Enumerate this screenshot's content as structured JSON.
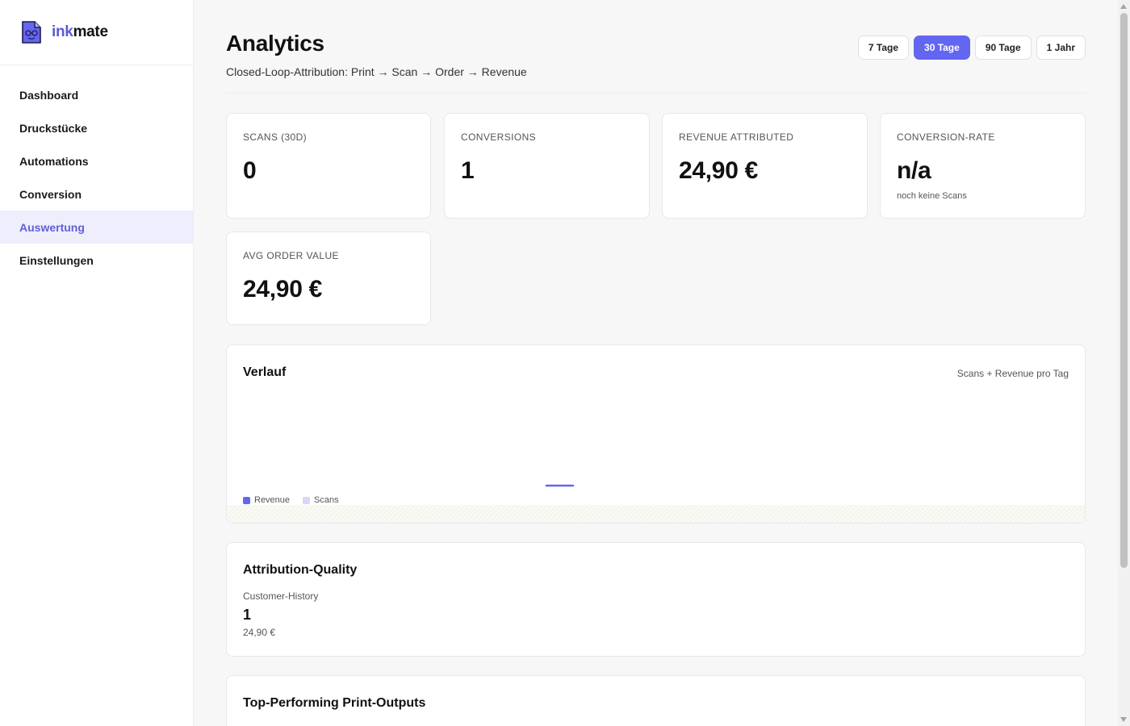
{
  "brand": {
    "ink": "ink",
    "mate": "mate",
    "accent": "#5b5bd6"
  },
  "sidebar": {
    "items": [
      {
        "label": "Dashboard",
        "active": false
      },
      {
        "label": "Druckstücke",
        "active": false
      },
      {
        "label": "Automations",
        "active": false
      },
      {
        "label": "Conversion",
        "active": false
      },
      {
        "label": "Auswertung",
        "active": true
      },
      {
        "label": "Einstellungen",
        "active": false
      }
    ]
  },
  "header": {
    "title": "Analytics",
    "subtitle": "Closed-Loop-Attribution: Print → Scan → Order → Revenue",
    "ranges": [
      {
        "label": "7 Tage",
        "active": false
      },
      {
        "label": "30 Tage",
        "active": true
      },
      {
        "label": "90 Tage",
        "active": false
      },
      {
        "label": "1 Jahr",
        "active": false
      }
    ]
  },
  "kpis": [
    {
      "label": "SCANS (30D)",
      "value": "0",
      "hint": ""
    },
    {
      "label": "CONVERSIONS",
      "value": "1",
      "hint": ""
    },
    {
      "label": "REVENUE ATTRIBUTED",
      "value": "24,90 €",
      "hint": ""
    },
    {
      "label": "CONVERSION-RATE",
      "value": "n/a",
      "hint": "noch keine Scans"
    },
    {
      "label": "AVG ORDER VALUE",
      "value": "24,90 €",
      "hint": ""
    }
  ],
  "chart": {
    "title": "Verlauf",
    "hint": "Scans + Revenue pro Tag"
  },
  "chart_data": {
    "type": "line",
    "title": "Verlauf",
    "series": [
      {
        "name": "Revenue",
        "color": "#6366f1"
      },
      {
        "name": "Scans",
        "color": "#d7d6f7"
      }
    ],
    "grid": false,
    "legend": "bottom-left"
  },
  "attribution": {
    "title": "Attribution-Quality",
    "label": "Customer-History",
    "count": "1",
    "revenue": "24,90 €"
  },
  "top_outputs": {
    "title": "Top-Performing Print-Outputs"
  }
}
